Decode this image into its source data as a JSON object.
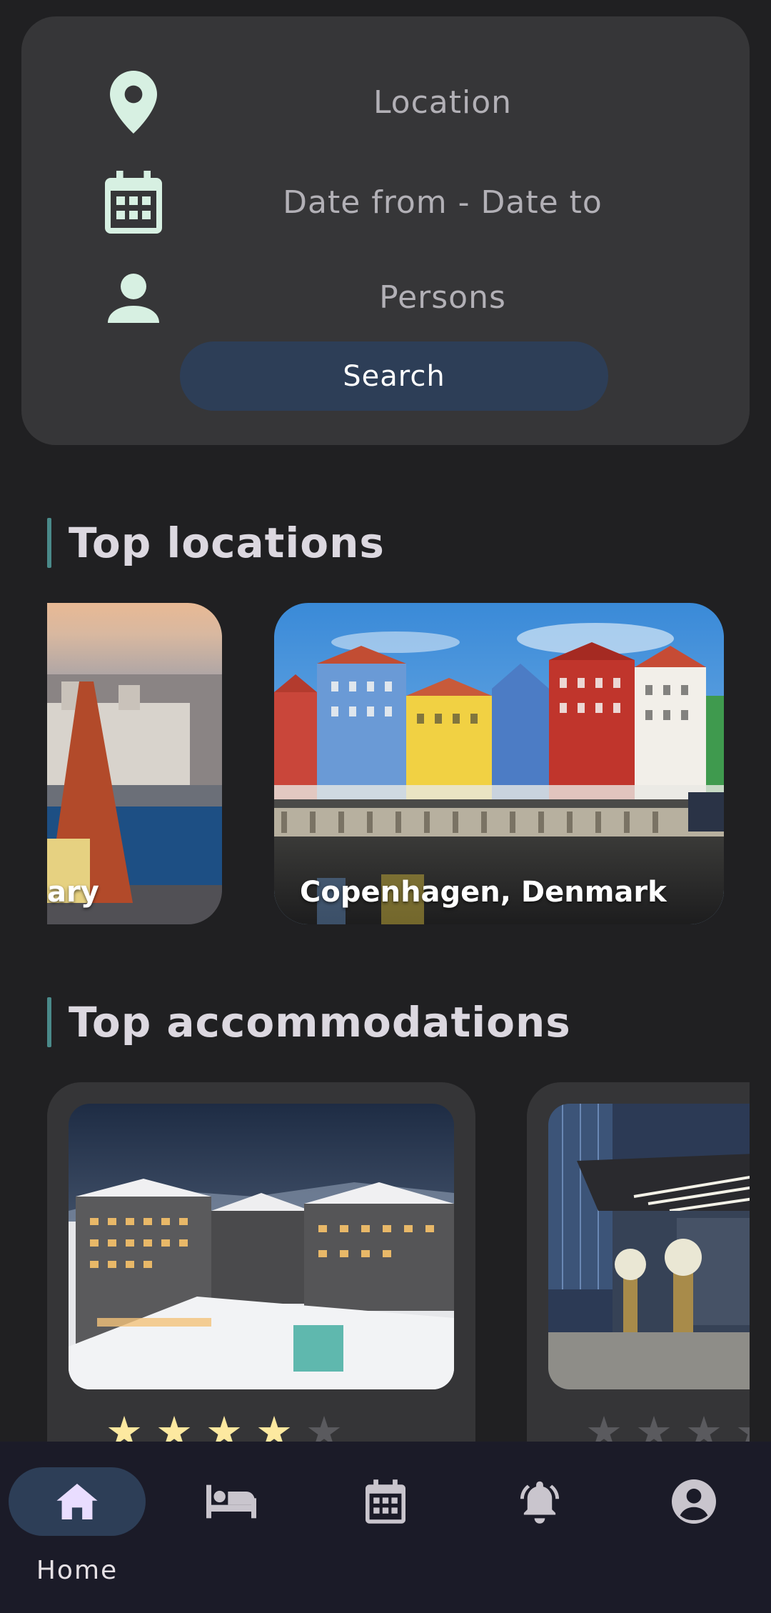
{
  "search": {
    "location_placeholder": "Location",
    "dates_placeholder": "Date from - Date to",
    "persons_placeholder": "Persons",
    "button_label": "Search"
  },
  "sections": {
    "top_locations": "Top locations",
    "top_accommodations": "Top accommodations"
  },
  "locations": [
    {
      "label": "ary"
    },
    {
      "label": "Copenhagen, Denmark"
    }
  ],
  "accommodations": [
    {
      "rating": 4,
      "max_rating": 5
    },
    {
      "rating": 0,
      "max_rating": 5
    }
  ],
  "nav": {
    "home_label": "Home"
  },
  "colors": {
    "accent_pill": "#2d3e57",
    "icon_mint": "#d7f0e2",
    "star_filled": "#fde9a0"
  }
}
